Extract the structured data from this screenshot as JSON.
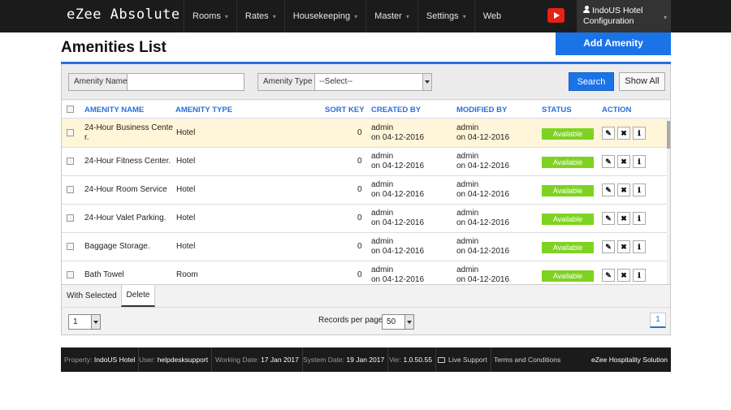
{
  "nav": {
    "brand": "eZee Absolute",
    "menu": [
      {
        "label": "Rooms",
        "caret": "▾"
      },
      {
        "label": "Rates",
        "caret": "▾"
      },
      {
        "label": "Housekeeping",
        "caret": "▾"
      },
      {
        "label": "Master",
        "caret": "▾"
      },
      {
        "label": "Settings",
        "caret": "▾"
      },
      {
        "label": "Web",
        "caret": ""
      }
    ],
    "user_line1": "IndoUS Hotel",
    "user_line2": "Configuration"
  },
  "page": {
    "title": "Amenities List",
    "add_button": "Add Amenity"
  },
  "filters": {
    "name_label": "Amenity Name",
    "name_value": "",
    "type_label": "Amenity Type",
    "type_value": "--Select--",
    "search_button": "Search",
    "show_all_button": "Show All"
  },
  "table": {
    "headers": {
      "name": "AMENITY NAME",
      "type": "AMENITY TYPE",
      "sort_key": "SORT KEY",
      "created_by": "CREATED BY",
      "modified_by": "MODIFIED BY",
      "status": "STATUS",
      "action": "ACTION"
    },
    "rows": [
      {
        "name_l1": "24-Hour Business Cente",
        "name_l2": "r.",
        "type": "Hotel",
        "sort_key": "0",
        "created_user": "admin",
        "created_date": "on 04-12-2016",
        "modified_user": "admin",
        "modified_date": "on 04-12-2016",
        "status": "Available"
      },
      {
        "name_l1": "24-Hour Fitness Center.",
        "name_l2": "",
        "type": "Hotel",
        "sort_key": "0",
        "created_user": "admin",
        "created_date": "on 04-12-2016",
        "modified_user": "admin",
        "modified_date": "on 04-12-2016",
        "status": "Available"
      },
      {
        "name_l1": "24-Hour Room Service",
        "name_l2": "",
        "type": "Hotel",
        "sort_key": "0",
        "created_user": "admin",
        "created_date": "on 04-12-2016",
        "modified_user": "admin",
        "modified_date": "on 04-12-2016",
        "status": "Available"
      },
      {
        "name_l1": "24-Hour Valet Parking.",
        "name_l2": "",
        "type": "Hotel",
        "sort_key": "0",
        "created_user": "admin",
        "created_date": "on 04-12-2016",
        "modified_user": "admin",
        "modified_date": "on 04-12-2016",
        "status": "Available"
      },
      {
        "name_l1": "Baggage Storage.",
        "name_l2": "",
        "type": "Hotel",
        "sort_key": "0",
        "created_user": "admin",
        "created_date": "on 04-12-2016",
        "modified_user": "admin",
        "modified_date": "on 04-12-2016",
        "status": "Available"
      },
      {
        "name_l1": "Bath Towel",
        "name_l2": "",
        "type": "Room",
        "sort_key": "0",
        "created_user": "admin",
        "created_date": "on 04-12-2016",
        "modified_user": "admin",
        "modified_date": "on 04-12-2016",
        "status": "Available"
      }
    ],
    "selected_row": 0,
    "action_icons": {
      "edit": "✎",
      "delete": "✖",
      "info": "ℹ"
    }
  },
  "bulk": {
    "with_selected": "With Selected",
    "delete": "Delete"
  },
  "pager": {
    "page_select": "1",
    "rpp_label": "Records per page",
    "rpp_value": "50",
    "current_page": "1"
  },
  "footer": {
    "property_label": "Property:",
    "property": "IndoUS Hotel",
    "user_label": "User:",
    "user": "helpdesksupport",
    "working_label": "Working Date:",
    "working_date": "17 Jan 2017",
    "system_label": "System Date:",
    "system_date": "19 Jan 2017",
    "ver_label": "Ver:",
    "version": "1.0.50.55",
    "live_support": "Live Support",
    "terms": "Terms and Conditions",
    "company": "eZee Hospitality Solution"
  },
  "colors": {
    "accent": "#1b73e8",
    "status_available": "#7ed321",
    "nav_bg": "#1b1b1b",
    "selected_row": "#fff5d9"
  }
}
